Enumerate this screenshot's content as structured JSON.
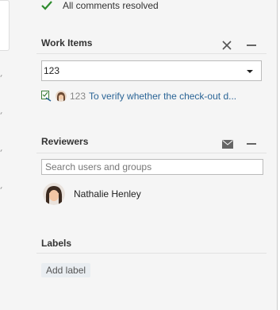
{
  "comments": {
    "resolved_text": "All comments resolved"
  },
  "work_items": {
    "title": "Work Items",
    "select_value": "123",
    "item": {
      "id": "123",
      "title": "To verify whether the check-out d..."
    }
  },
  "reviewers": {
    "title": "Reviewers",
    "search_placeholder": "Search users and groups",
    "people": [
      {
        "name": "Nathalie Henley"
      }
    ]
  },
  "labels": {
    "title": "Labels",
    "add_label": "Add label"
  },
  "colors": {
    "accent_link": "#2a6496",
    "success_check": "#2e8b2e"
  }
}
